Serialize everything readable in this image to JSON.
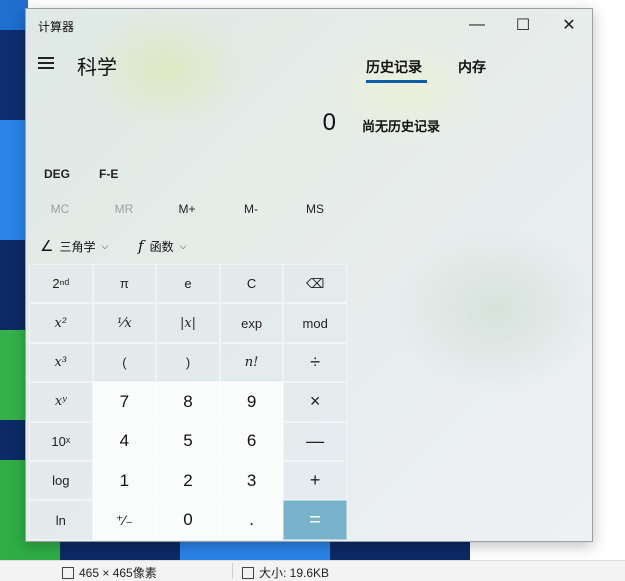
{
  "window": {
    "title": "计算器",
    "minimize_glyph": "—",
    "maximize_glyph": "☐",
    "close_glyph": "✕"
  },
  "header": {
    "mode": "科学",
    "tabs": [
      "历史记录",
      "内存"
    ]
  },
  "display": {
    "value": "0",
    "history_empty": "尚无历史记录"
  },
  "angle": {
    "deg": "DEG",
    "fe": "F-E"
  },
  "memory": [
    "MC",
    "MR",
    "M+",
    "M-",
    "MS"
  ],
  "functions": {
    "trig_label": "三角学",
    "trig_icon": "∠",
    "func_icon": "f",
    "func_label": "函数",
    "chevron": "⌵"
  },
  "keys": [
    [
      "2ⁿᵈ",
      "π",
      "e",
      "C",
      "⌫"
    ],
    [
      "x²",
      "¹⁄x",
      "|x|",
      "exp",
      "mod"
    ],
    [
      "x³",
      "(",
      ")",
      "n!",
      "÷"
    ],
    [
      "xʸ",
      "7",
      "8",
      "9",
      "×"
    ],
    [
      "10ˣ",
      "4",
      "5",
      "6",
      "—"
    ],
    [
      "log",
      "1",
      "2",
      "3",
      "+"
    ],
    [
      "ln",
      "⁺⁄₋",
      "0",
      ".",
      "="
    ]
  ],
  "status_bar": {
    "dimensions": "465 × 465像素",
    "size": "大小: 19.6KB"
  },
  "colors": {
    "accent_underline": "#0a5fa8",
    "equals_key": "#76b2c9"
  }
}
